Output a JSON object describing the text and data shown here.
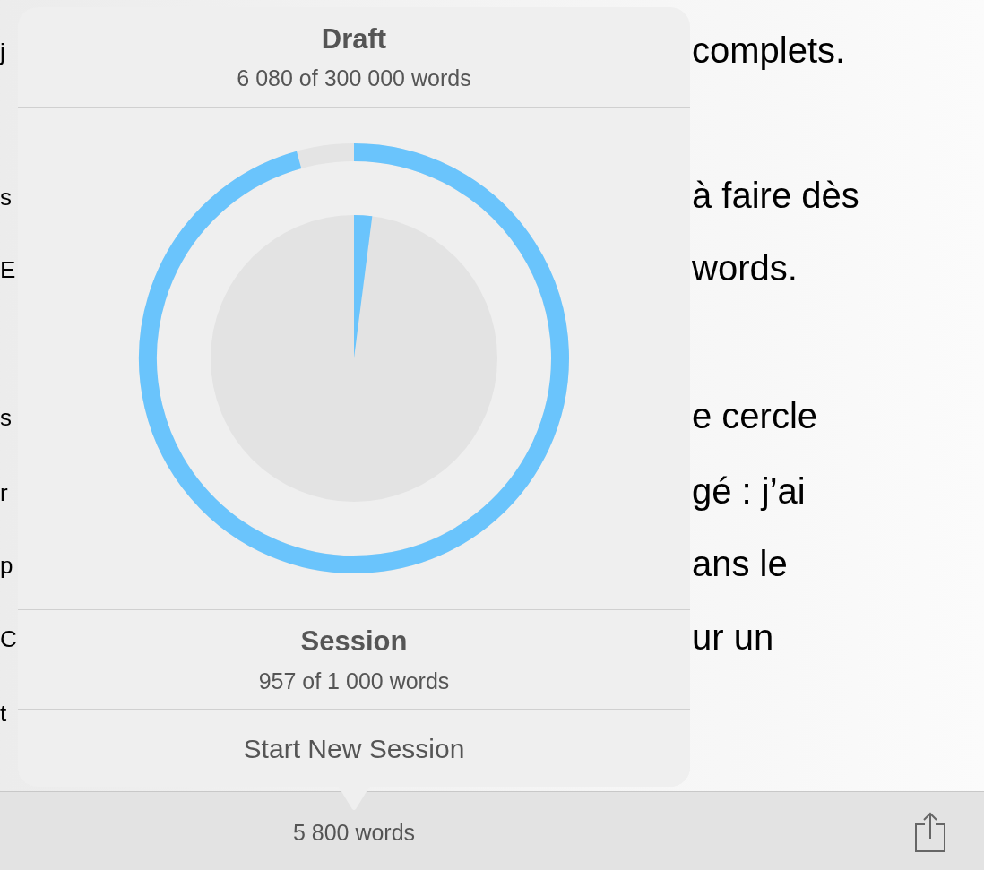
{
  "document": {
    "left_fragments": [
      "j",
      "s",
      "E",
      "s",
      "r",
      "p",
      "C",
      "t"
    ],
    "right_fragments": [
      "complets.",
      "à faire dès",
      "words.",
      "e cercle",
      "gé : j’ai",
      "ans le",
      "ur un"
    ]
  },
  "popover": {
    "draft": {
      "title": "Draft",
      "progress": "6 080 of 300 000 words"
    },
    "session": {
      "title": "Session",
      "progress": "957 of 1 000 words"
    },
    "button": "Start New Session"
  },
  "status_bar": {
    "word_count": "5 800 words"
  }
}
